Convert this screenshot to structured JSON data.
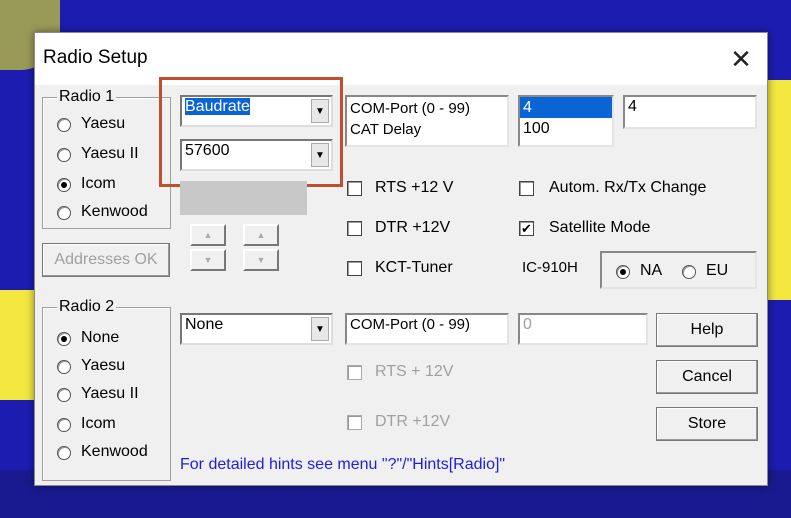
{
  "window": {
    "title": "Radio Setup",
    "close_glyph": "✕"
  },
  "radio1": {
    "legend": "Radio 1",
    "options": [
      "Yaesu",
      "Yaesu II",
      "Icom",
      "Kenwood"
    ],
    "selected": "Icom",
    "combo_param": "Baudrate",
    "combo_value": "57600",
    "port_label_line1": "COM-Port (0 - 99)",
    "port_label_line2": "CAT Delay",
    "port_list": [
      "4",
      "100"
    ],
    "port_value": "4",
    "rts": "RTS +12 V",
    "dtr": "DTR +12V",
    "kct": "KCT-Tuner",
    "autom": "Autom. Rx/Tx Change",
    "satellite": "Satellite Mode",
    "satellite_checked": true,
    "model": "IC-910H",
    "region_na": "NA",
    "region_eu": "EU",
    "region_selected": "NA"
  },
  "addresses_button": "Addresses OK",
  "radio2": {
    "legend": "Radio 2",
    "options": [
      "None",
      "Yaesu",
      "Yaesu II",
      "Icom",
      "Kenwood"
    ],
    "selected": "None",
    "combo_value": "None",
    "port_label": "COM-Port (0 - 99)",
    "port_value": "0",
    "rts": "RTS + 12V",
    "dtr": "DTR +12V"
  },
  "buttons": {
    "help": "Help",
    "cancel": "Cancel",
    "store": "Store"
  },
  "hint": "For detailed hints see menu \"?\"/\"Hints[Radio]\"",
  "colors": {
    "highlight_box": "#c0502c",
    "hint_text": "#1e1ee0",
    "selection": "#0a64d6"
  }
}
